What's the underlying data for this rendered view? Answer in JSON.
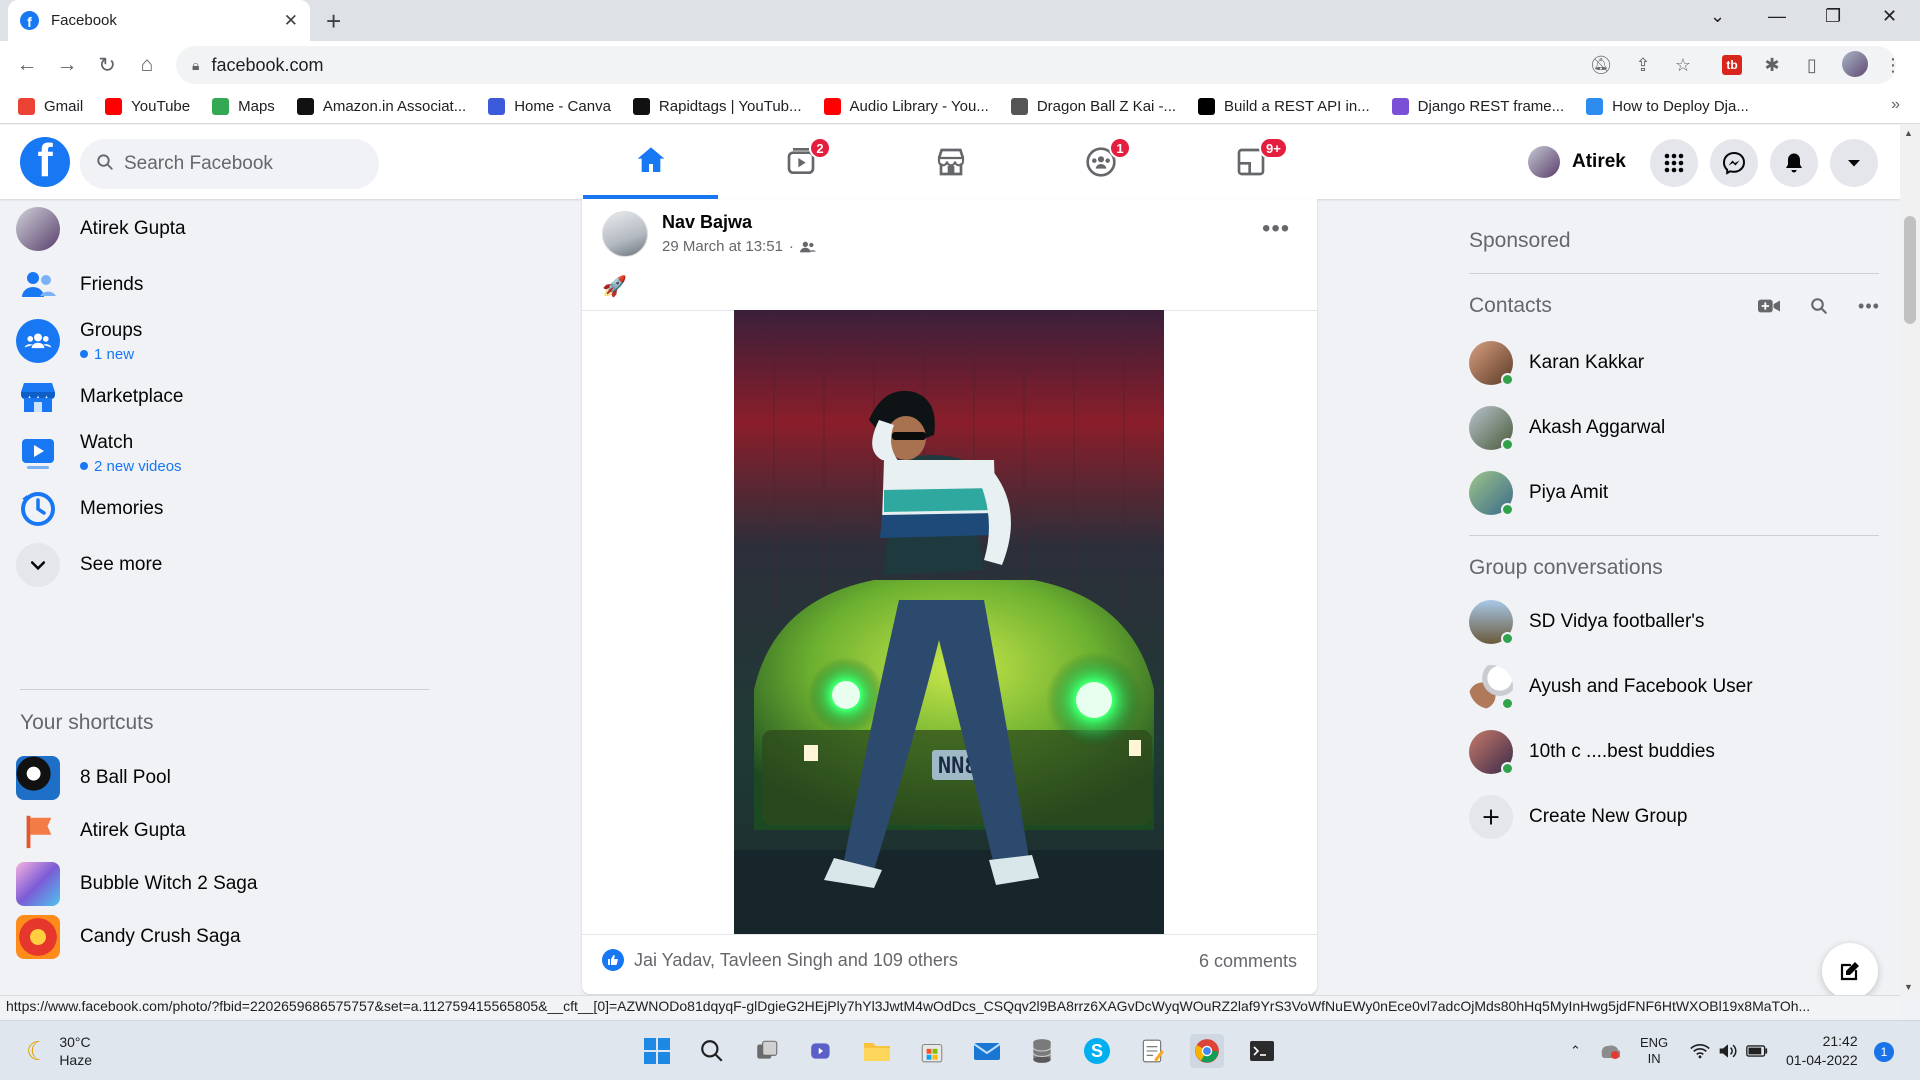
{
  "browser": {
    "tab_title": "Facebook",
    "url": "facebook.com",
    "bookmarks": [
      {
        "label": "Gmail",
        "icon": "gmail-icon",
        "color": "#ea4335"
      },
      {
        "label": "YouTube",
        "icon": "youtube-icon",
        "color": "#ff0000"
      },
      {
        "label": "Maps",
        "icon": "maps-icon",
        "color": "#34a853"
      },
      {
        "label": "Amazon.in Associat...",
        "icon": "amazon-icon",
        "color": "#111111"
      },
      {
        "label": "Home - Canva",
        "icon": "canva-icon",
        "color": "#3b5bdb"
      },
      {
        "label": "Rapidtags | YouTub...",
        "icon": "rapidtags-icon",
        "color": "#111111"
      },
      {
        "label": "Audio Library - You...",
        "icon": "youtube-icon",
        "color": "#ff0000"
      },
      {
        "label": "Dragon Ball Z Kai -...",
        "icon": "dragonball-icon",
        "color": "#555555"
      },
      {
        "label": "Build a REST API in...",
        "icon": "medium-icon",
        "color": "#000000"
      },
      {
        "label": "Django REST frame...",
        "icon": "django-icon",
        "color": "#7b4fd6"
      },
      {
        "label": "How to Deploy Dja...",
        "icon": "sitepoint-icon",
        "color": "#2d8cf0"
      }
    ]
  },
  "header": {
    "search_placeholder": "Search Facebook",
    "user_name": "Atirek",
    "badges": {
      "watch": "2",
      "groups": "1",
      "gaming": "9+"
    }
  },
  "left_nav": {
    "profile": "Atirek Gupta",
    "items": [
      {
        "label": "Friends",
        "sub": ""
      },
      {
        "label": "Groups",
        "sub": "1 new"
      },
      {
        "label": "Marketplace",
        "sub": ""
      },
      {
        "label": "Watch",
        "sub": "2 new videos"
      },
      {
        "label": "Memories",
        "sub": ""
      },
      {
        "label": "See more",
        "sub": ""
      }
    ],
    "shortcuts_title": "Your shortcuts",
    "shortcuts": [
      "8 Ball Pool",
      "Atirek Gupta",
      "Bubble Witch 2 Saga",
      "Candy Crush Saga"
    ]
  },
  "post": {
    "author": "Nav Bajwa",
    "time": "29 March at 13:51",
    "audience_icon": "friends-icon",
    "caption_emoji": "🚀",
    "plate_text": "NN810",
    "reactions": "Jai Yadav, Tavleen Singh and 109 others",
    "comments": "6 comments"
  },
  "right": {
    "sponsored": "Sponsored",
    "contacts_title": "Contacts",
    "contacts": [
      "Karan Kakkar",
      "Akash Aggarwal",
      "Piya Amit"
    ],
    "groups_title": "Group conversations",
    "groups": [
      "SD Vidya footballer's",
      "Ayush and Facebook User",
      "10th c ....best buddies"
    ],
    "create_group": "Create New Group"
  },
  "status_url": "https://www.facebook.com/photo/?fbid=2202659686575757&set=a.112759415565805&__cft__[0]=AZWNODo81dqyqF-glDgieG2HEjPly7hYl3JwtM4wOdDcs_CSQqv2l9BA8rrz6XAGvDcWyqWOuRZ2laf9YrS3VoWfNuEWy0nEce0vl7adcOjMds80hHq5MyInHwg5jdFNF6HtWXOBl19x8MaTOh...",
  "taskbar": {
    "temp": "30°C",
    "weather": "Haze",
    "lang1": "ENG",
    "lang2": "IN",
    "time": "21:42",
    "date": "01-04-2022",
    "notifications": "1"
  },
  "colors": {
    "brand": "#1877f2",
    "badge": "#e41e3f",
    "online": "#31a24c"
  }
}
